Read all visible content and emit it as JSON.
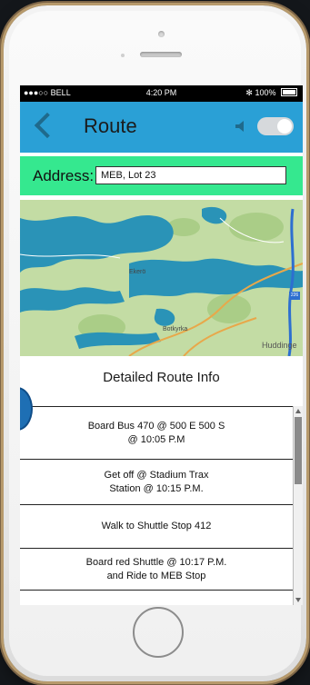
{
  "status": {
    "carrier": "●●●○○ BELL",
    "time": "4:20 PM",
    "battery": "✻ 100%"
  },
  "header": {
    "title": "Route",
    "back_icon": "chevron-left-icon",
    "sound_icon": "speaker-icon"
  },
  "address": {
    "label": "Address:",
    "value": "MEB, Lot 23"
  },
  "map": {
    "labels": {
      "ekero": "Ekerö",
      "botkyrka": "Botkyrka",
      "huddinge": "Huddinge",
      "route_shield": "226"
    }
  },
  "route_info": {
    "title": "Detailed Route Info",
    "steps": [
      {
        "line1": "Board Bus 470 @ 500 E 500 S",
        "line2": "@ 10:05 P.M"
      },
      {
        "line1": "Get off @ Stadium Trax",
        "line2": "Station @ 10:15 P.M."
      },
      {
        "line1": "Walk to Shuttle Stop 412",
        "line2": ""
      },
      {
        "line1": "Board red Shuttle @ 10:17 P.M.",
        "line2": "and Ride to MEB Stop"
      }
    ]
  },
  "colors": {
    "header": "#2aa0d6",
    "address_bar": "#35e88f",
    "map_water": "#2a93b7",
    "map_land": "#bcd79a"
  }
}
